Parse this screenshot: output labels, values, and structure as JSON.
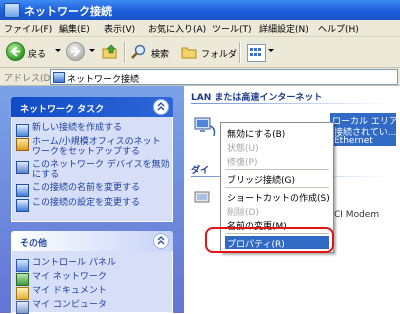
{
  "window": {
    "title": "ネットワーク接続"
  },
  "menubar": [
    "ファイル(F)",
    "編集(E)",
    "表示(V)",
    "お気に入り(A)",
    "ツール(T)",
    "詳細設定(N)",
    "ヘルプ(H)"
  ],
  "toolbar": {
    "back_label": "戻る",
    "search_label": "検索",
    "folders_label": "フォルダ"
  },
  "address": {
    "label": "アドレス(D)",
    "value": "ネットワーク接続"
  },
  "network_tasks": {
    "title": "ネットワーク タスク",
    "items": [
      "新しい接続を作成する",
      "ホーム/小規模オフィスのネット",
      "ワークをセットアップする",
      "このネットワーク デバイスを無効",
      "にする",
      "この接続の名前を変更する",
      "この接続の設定を変更する"
    ]
  },
  "other_places": {
    "title": "その他",
    "items": [
      "コントロール パネル",
      "マイ ネットワーク",
      "マイ ドキュメント",
      "マイ コンピュータ"
    ]
  },
  "content": {
    "group1": "LAN または高速インターネット",
    "group2": "ダイ",
    "conn_name": "ローカル エリア接続",
    "conn_status": "接続されてい...",
    "conn_device": "Ethernet",
    "dialup_device": "CI Modem"
  },
  "context_menu": {
    "items": [
      "無効にする(B)",
      "状態(U)",
      "修復(P)",
      "ブリッジ接続(G)",
      "ショートカットの作成(S)",
      "削除(D)",
      "名前の変更(M)",
      "プロパティ(R)"
    ],
    "disabled": [
      "状態(U)",
      "修復(P)",
      "削除(D)"
    ],
    "highlighted": "プロパティ(R)"
  },
  "colors": {
    "titlebar": "#1d5ed8",
    "highlight": "#316ac5",
    "callout": "#e01414",
    "link": "#1c3ea0"
  }
}
